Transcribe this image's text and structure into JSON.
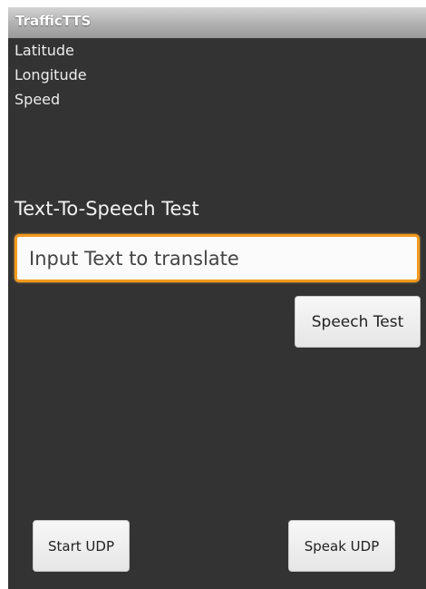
{
  "app": {
    "title": "TrafficTTS"
  },
  "location": {
    "latitude_label": "Latitude",
    "longitude_label": "Longitude",
    "speed_label": "Speed"
  },
  "tts": {
    "section_label": "Text-To-Speech Test",
    "input_placeholder": "Input Text to translate",
    "input_value": "",
    "speech_test_label": "Speech Test"
  },
  "udp": {
    "start_label": "Start UDP",
    "speak_label": "Speak UDP"
  },
  "colors": {
    "background": "#333333",
    "title_bar": "#b0b0b0",
    "input_focus_border": "#f29a1e",
    "button_face": "#eeeeee"
  }
}
